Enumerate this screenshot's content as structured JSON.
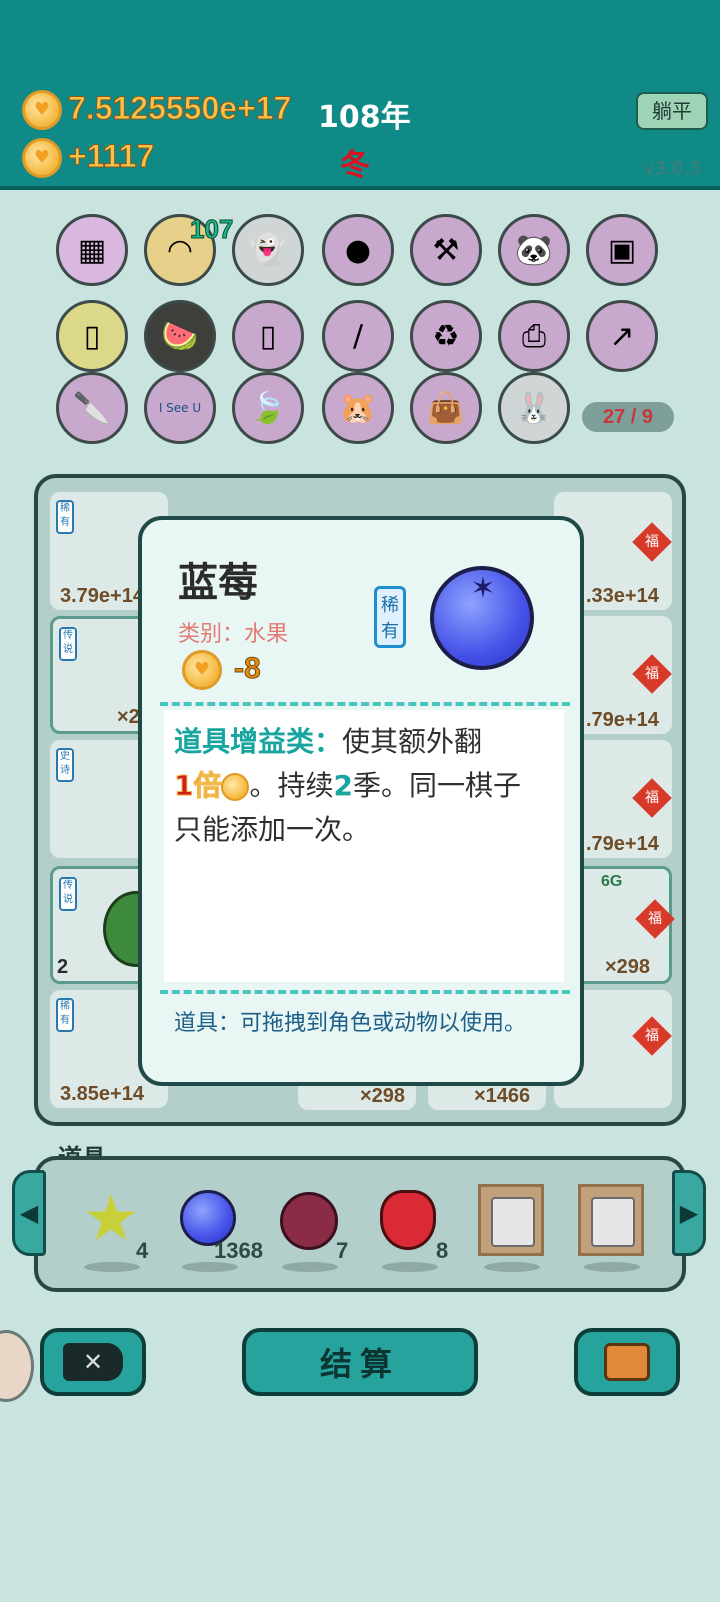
{
  "header": {
    "money_total": "7.5125550e+17",
    "year": "108年",
    "money_income": "+1117",
    "season": "冬",
    "lie_flat_button": "躺平",
    "version": "v3.0.3"
  },
  "characters": {
    "badge_count": "107",
    "page": "27 / 9",
    "icons": [
      "skirt-icon",
      "shell-icon",
      "ghost-icon",
      "egg-icon",
      "hammer-icon",
      "panda-icon",
      "purse-icon",
      "card-pack-icon",
      "fruit-basket-icon",
      "card-pack-icon",
      "screwdriver-icon",
      "recycle-icon",
      "printer-icon",
      "arrow-card-icon",
      "cleaver-icon",
      "i-see-u-sign-icon",
      "leaf-icon",
      "hamsters-icon",
      "bag-icon",
      "bunny-icon"
    ],
    "i_see_u_text": "I See U"
  },
  "board": {
    "cells": [
      {
        "tag": "稀有",
        "value": "3.79e+14"
      },
      {
        "tag": "传说",
        "value": "×2"
      },
      {
        "tag": "史诗",
        "value": ""
      },
      {
        "tag": "传说",
        "value": "2"
      },
      {
        "tag": "稀有",
        "value": "3.85e+14"
      },
      {
        "value": ".33e+14",
        "fu": "福"
      },
      {
        "value": ".79e+14",
        "fu": "福"
      },
      {
        "value": ".79e+14",
        "fu": "福"
      },
      {
        "value": "×298",
        "fu": "福",
        "crown": "6G"
      },
      {
        "value": "",
        "fu": "福"
      },
      {
        "value": "×298"
      },
      {
        "value": "×1466"
      }
    ],
    "crown_label_left": "6G"
  },
  "popup": {
    "title": "蓝莓",
    "category": "类别：水果",
    "rarity": "稀有",
    "cost": "-8",
    "desc_type": "道具增益类：",
    "desc_part1": "使其额外翻",
    "desc_multiplier": "1倍",
    "desc_part2": "。持续",
    "desc_duration": "2",
    "desc_part3": "季。同一棋子只能添加一次。",
    "hint": "道具：可拖拽到角色或动物以使用。"
  },
  "tray": {
    "label": "道具",
    "items": [
      {
        "icon": "star-icon",
        "count": "4"
      },
      {
        "icon": "blueberry-icon",
        "count": "1368"
      },
      {
        "icon": "bayberry-icon",
        "count": "7"
      },
      {
        "icon": "strawberry-icon",
        "count": "8"
      },
      {
        "icon": "copy-paste-card-icon",
        "count": ""
      },
      {
        "icon": "copy-paste-card-icon",
        "count": ""
      }
    ]
  },
  "buttons": {
    "settle": "结算"
  },
  "colors": {
    "topbar": "#0f8a86",
    "accent": "#26a39c",
    "money": "#f6c24a",
    "season": "#d9121f"
  }
}
